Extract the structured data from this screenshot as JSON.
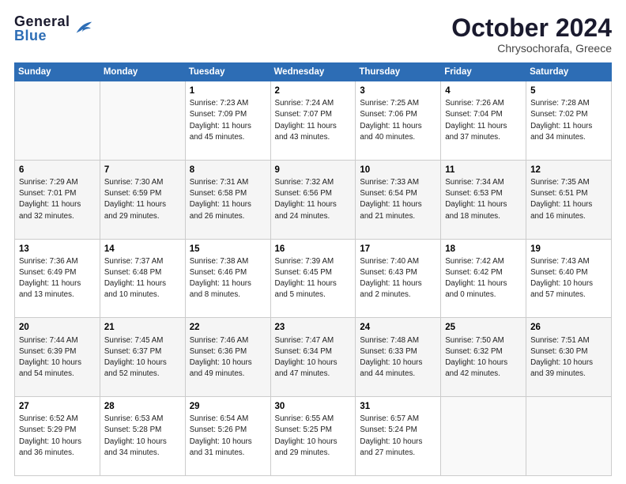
{
  "header": {
    "logo_general": "General",
    "logo_blue": "Blue",
    "month_title": "October 2024",
    "location": "Chrysochorafa, Greece"
  },
  "calendar": {
    "days_of_week": [
      "Sunday",
      "Monday",
      "Tuesday",
      "Wednesday",
      "Thursday",
      "Friday",
      "Saturday"
    ],
    "weeks": [
      [
        {
          "day": "",
          "info": ""
        },
        {
          "day": "",
          "info": ""
        },
        {
          "day": "1",
          "info": "Sunrise: 7:23 AM\nSunset: 7:09 PM\nDaylight: 11 hours and 45 minutes."
        },
        {
          "day": "2",
          "info": "Sunrise: 7:24 AM\nSunset: 7:07 PM\nDaylight: 11 hours and 43 minutes."
        },
        {
          "day": "3",
          "info": "Sunrise: 7:25 AM\nSunset: 7:06 PM\nDaylight: 11 hours and 40 minutes."
        },
        {
          "day": "4",
          "info": "Sunrise: 7:26 AM\nSunset: 7:04 PM\nDaylight: 11 hours and 37 minutes."
        },
        {
          "day": "5",
          "info": "Sunrise: 7:28 AM\nSunset: 7:02 PM\nDaylight: 11 hours and 34 minutes."
        }
      ],
      [
        {
          "day": "6",
          "info": "Sunrise: 7:29 AM\nSunset: 7:01 PM\nDaylight: 11 hours and 32 minutes."
        },
        {
          "day": "7",
          "info": "Sunrise: 7:30 AM\nSunset: 6:59 PM\nDaylight: 11 hours and 29 minutes."
        },
        {
          "day": "8",
          "info": "Sunrise: 7:31 AM\nSunset: 6:58 PM\nDaylight: 11 hours and 26 minutes."
        },
        {
          "day": "9",
          "info": "Sunrise: 7:32 AM\nSunset: 6:56 PM\nDaylight: 11 hours and 24 minutes."
        },
        {
          "day": "10",
          "info": "Sunrise: 7:33 AM\nSunset: 6:54 PM\nDaylight: 11 hours and 21 minutes."
        },
        {
          "day": "11",
          "info": "Sunrise: 7:34 AM\nSunset: 6:53 PM\nDaylight: 11 hours and 18 minutes."
        },
        {
          "day": "12",
          "info": "Sunrise: 7:35 AM\nSunset: 6:51 PM\nDaylight: 11 hours and 16 minutes."
        }
      ],
      [
        {
          "day": "13",
          "info": "Sunrise: 7:36 AM\nSunset: 6:49 PM\nDaylight: 11 hours and 13 minutes."
        },
        {
          "day": "14",
          "info": "Sunrise: 7:37 AM\nSunset: 6:48 PM\nDaylight: 11 hours and 10 minutes."
        },
        {
          "day": "15",
          "info": "Sunrise: 7:38 AM\nSunset: 6:46 PM\nDaylight: 11 hours and 8 minutes."
        },
        {
          "day": "16",
          "info": "Sunrise: 7:39 AM\nSunset: 6:45 PM\nDaylight: 11 hours and 5 minutes."
        },
        {
          "day": "17",
          "info": "Sunrise: 7:40 AM\nSunset: 6:43 PM\nDaylight: 11 hours and 2 minutes."
        },
        {
          "day": "18",
          "info": "Sunrise: 7:42 AM\nSunset: 6:42 PM\nDaylight: 11 hours and 0 minutes."
        },
        {
          "day": "19",
          "info": "Sunrise: 7:43 AM\nSunset: 6:40 PM\nDaylight: 10 hours and 57 minutes."
        }
      ],
      [
        {
          "day": "20",
          "info": "Sunrise: 7:44 AM\nSunset: 6:39 PM\nDaylight: 10 hours and 54 minutes."
        },
        {
          "day": "21",
          "info": "Sunrise: 7:45 AM\nSunset: 6:37 PM\nDaylight: 10 hours and 52 minutes."
        },
        {
          "day": "22",
          "info": "Sunrise: 7:46 AM\nSunset: 6:36 PM\nDaylight: 10 hours and 49 minutes."
        },
        {
          "day": "23",
          "info": "Sunrise: 7:47 AM\nSunset: 6:34 PM\nDaylight: 10 hours and 47 minutes."
        },
        {
          "day": "24",
          "info": "Sunrise: 7:48 AM\nSunset: 6:33 PM\nDaylight: 10 hours and 44 minutes."
        },
        {
          "day": "25",
          "info": "Sunrise: 7:50 AM\nSunset: 6:32 PM\nDaylight: 10 hours and 42 minutes."
        },
        {
          "day": "26",
          "info": "Sunrise: 7:51 AM\nSunset: 6:30 PM\nDaylight: 10 hours and 39 minutes."
        }
      ],
      [
        {
          "day": "27",
          "info": "Sunrise: 6:52 AM\nSunset: 5:29 PM\nDaylight: 10 hours and 36 minutes."
        },
        {
          "day": "28",
          "info": "Sunrise: 6:53 AM\nSunset: 5:28 PM\nDaylight: 10 hours and 34 minutes."
        },
        {
          "day": "29",
          "info": "Sunrise: 6:54 AM\nSunset: 5:26 PM\nDaylight: 10 hours and 31 minutes."
        },
        {
          "day": "30",
          "info": "Sunrise: 6:55 AM\nSunset: 5:25 PM\nDaylight: 10 hours and 29 minutes."
        },
        {
          "day": "31",
          "info": "Sunrise: 6:57 AM\nSunset: 5:24 PM\nDaylight: 10 hours and 27 minutes."
        },
        {
          "day": "",
          "info": ""
        },
        {
          "day": "",
          "info": ""
        }
      ]
    ]
  }
}
